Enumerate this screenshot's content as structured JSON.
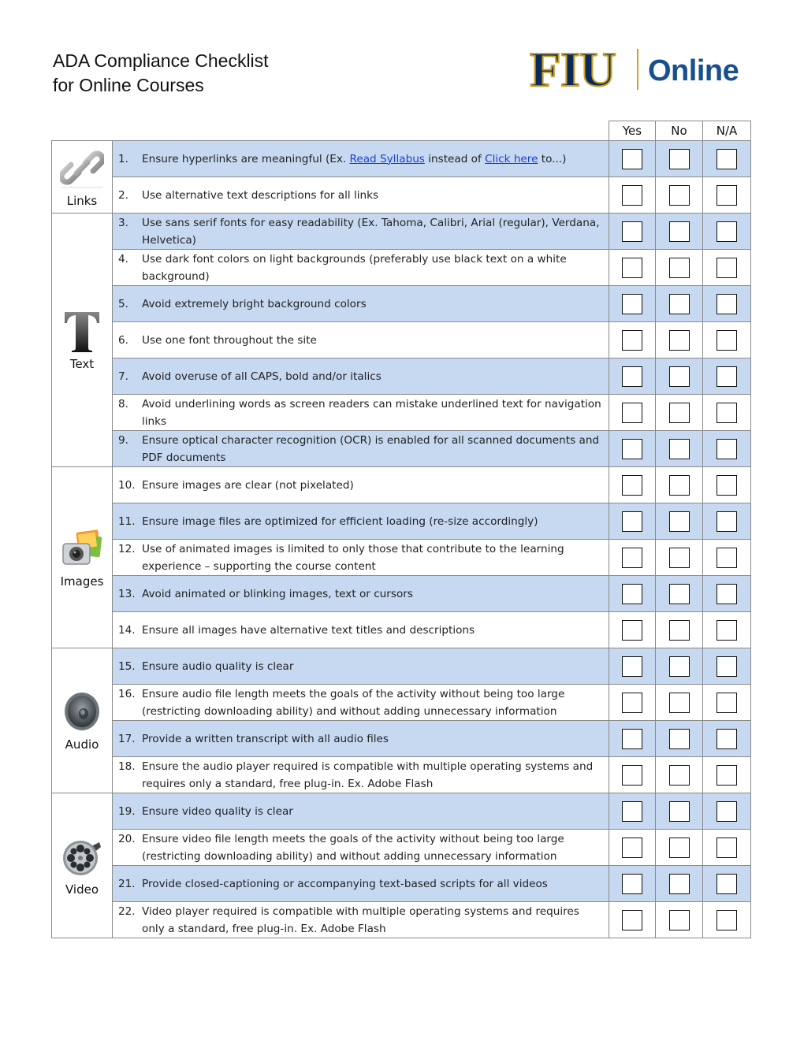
{
  "header": {
    "title_line1": "ADA Compliance Checklist",
    "title_line2": "for Online Courses",
    "logo_primary": "FIU",
    "logo_secondary": "Online"
  },
  "columns": [
    "Yes",
    "No",
    "N/A"
  ],
  "colors": {
    "alt_row": "#c6d9f1",
    "link": "#1a3fd6",
    "logo_navy": "#0b2a5c",
    "logo_gold": "#c9a227",
    "logo_online": "#184f8f"
  },
  "sections": [
    {
      "name": "Links",
      "icon": "link-chain-icon",
      "items": [
        {
          "num": "1.",
          "parts": [
            "Ensure hyperlinks are meaningful (Ex. ",
            "Read Syllabus",
            " instead of ",
            "Click here",
            " to...)"
          ],
          "links": [
            "Read Syllabus",
            "Click here"
          ]
        },
        {
          "num": "2.",
          "text": "Use alternative text descriptions for all links"
        }
      ]
    },
    {
      "name": "Text",
      "icon": "serif-t-icon",
      "items": [
        {
          "num": "3.",
          "text": "Use sans serif fonts for easy readability (Ex. Tahoma, Calibri, Arial (regular), Verdana, Helvetica)"
        },
        {
          "num": "4.",
          "text": "Use dark font colors on light backgrounds (preferably use black text on a white background)"
        },
        {
          "num": "5.",
          "text": "Avoid extremely bright background colors"
        },
        {
          "num": "6.",
          "text": "Use one font throughout the site"
        },
        {
          "num": "7.",
          "text": "Avoid overuse of all CAPS, bold and/or italics"
        },
        {
          "num": "8.",
          "text": "Avoid underlining words as screen readers can mistake underlined text for navigation links"
        },
        {
          "num": "9.",
          "text": "Ensure optical character recognition (OCR) is enabled for all scanned documents and PDF documents"
        }
      ]
    },
    {
      "name": "Images",
      "icon": "camera-photo-icon",
      "items": [
        {
          "num": "10.",
          "text": "Ensure images are clear (not pixelated)"
        },
        {
          "num": "11.",
          "text": "Ensure image files are optimized for efficient loading (re-size accordingly)"
        },
        {
          "num": "12.",
          "text": "Use of animated images is limited to only those that contribute to the learning experience – supporting the course content"
        },
        {
          "num": "13.",
          "text": "Avoid animated or blinking images, text or cursors"
        },
        {
          "num": "14.",
          "text": "Ensure all images have alternative text titles and descriptions"
        }
      ]
    },
    {
      "name": "Audio",
      "icon": "speaker-icon",
      "items": [
        {
          "num": "15.",
          "text": "Ensure audio quality is clear"
        },
        {
          "num": "16.",
          "text": "Ensure audio file length meets the goals of the activity without being too large (restricting downloading ability) and without adding unnecessary information"
        },
        {
          "num": "17.",
          "text": "Provide a written transcript with all audio files"
        },
        {
          "num": "18.",
          "text": "Ensure the audio player required is compatible with multiple operating systems and requires only a standard, free plug-in. Ex. Adobe Flash"
        }
      ]
    },
    {
      "name": "Video",
      "icon": "film-reel-icon",
      "items": [
        {
          "num": "19.",
          "text": "Ensure video quality is clear"
        },
        {
          "num": "20.",
          "text": "Ensure video file length meets the goals of the activity without being too large (restricting downloading ability) and without adding unnecessary information"
        },
        {
          "num": "21.",
          "text": "Provide closed-captioning or accompanying text-based scripts for all videos"
        },
        {
          "num": "22.",
          "text": "Video player required is compatible with multiple operating systems and requires only a standard, free plug-in. Ex. Adobe Flash"
        }
      ]
    }
  ]
}
